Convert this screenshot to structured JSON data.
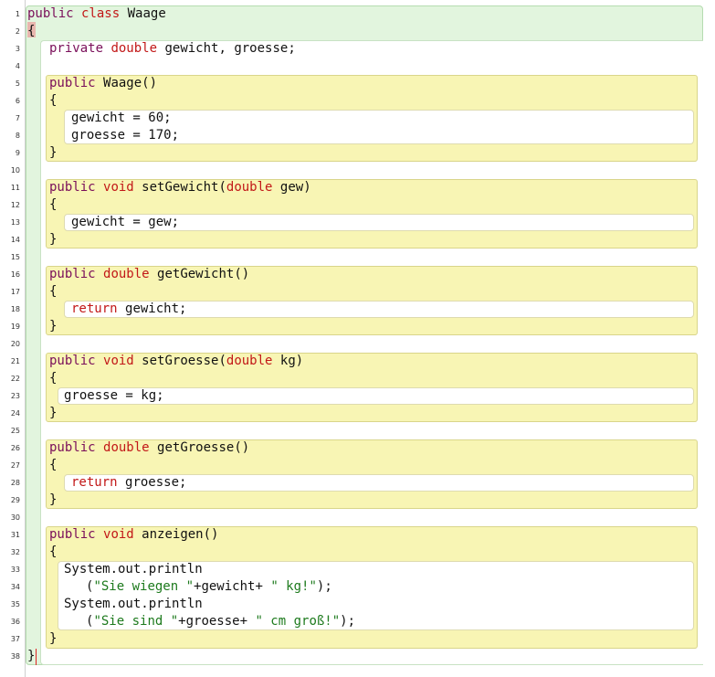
{
  "editor": {
    "line_numbers": [
      "1",
      "2",
      "3",
      "4",
      "5",
      "6",
      "7",
      "8",
      "9",
      "10",
      "11",
      "12",
      "13",
      "14",
      "15",
      "16",
      "17",
      "18",
      "19",
      "20",
      "21",
      "22",
      "23",
      "24",
      "25",
      "26",
      "27",
      "28",
      "29",
      "30",
      "31",
      "32",
      "33",
      "34",
      "35",
      "36",
      "37",
      "38"
    ],
    "class": {
      "kw_public": "public",
      "kw_class": "class",
      "name": "Waage",
      "open_brace": "{",
      "close_brace": "}"
    },
    "fields": {
      "kw_private": "private",
      "type": "double",
      "names": "gewicht, groesse;"
    },
    "constructor": {
      "kw_public": "public",
      "signature": "Waage()",
      "open_brace": "{",
      "body": [
        "gewicht = 60;",
        "groesse = 170;"
      ],
      "close_brace": "}"
    },
    "set_gewicht": {
      "kw_public": "public",
      "kw_void": "void",
      "name_open": "setGewicht(",
      "param_type": "double",
      "param_rest": "gew)",
      "open_brace": "{",
      "body": "gewicht = gew;",
      "close_brace": "}"
    },
    "get_gewicht": {
      "kw_public": "public",
      "kw_type": "double",
      "name": "getGewicht()",
      "open_brace": "{",
      "kw_return": "return",
      "body": "gewicht;",
      "close_brace": "}"
    },
    "set_groesse": {
      "kw_public": "public",
      "kw_void": "void",
      "name_open": "setGroesse(",
      "param_type": "double",
      "param_rest": "kg)",
      "open_brace": "{",
      "body": "groesse = kg;",
      "close_brace": "}"
    },
    "get_groesse": {
      "kw_public": "public",
      "kw_type": "double",
      "name": "getGroesse()",
      "open_brace": "{",
      "kw_return": "return",
      "body": "groesse;",
      "close_brace": "}"
    },
    "anzeigen": {
      "kw_public": "public",
      "kw_void": "void",
      "name": "anzeigen()",
      "open_brace": "{",
      "println1": "System.out.println",
      "str1_open": "(",
      "str1": "\"Sie wiegen \"",
      "str1_mid": "+gewicht+ ",
      "str1_end": "\" kg!\"",
      "str1_close": ");",
      "println2": "System.out.println",
      "str2_open": "(",
      "str2": "\"Sie sind \"",
      "str2_mid": "+groesse+ ",
      "str2_end": "\" cm groß!\"",
      "str2_close": ");",
      "close_brace": "}"
    },
    "colors": {
      "class_block": "#e2f5de",
      "method_block": "#f8f5b4",
      "keyword_modifier": "#7a0f5a",
      "keyword_type": "#c21818",
      "string": "#1d7a1d"
    }
  }
}
